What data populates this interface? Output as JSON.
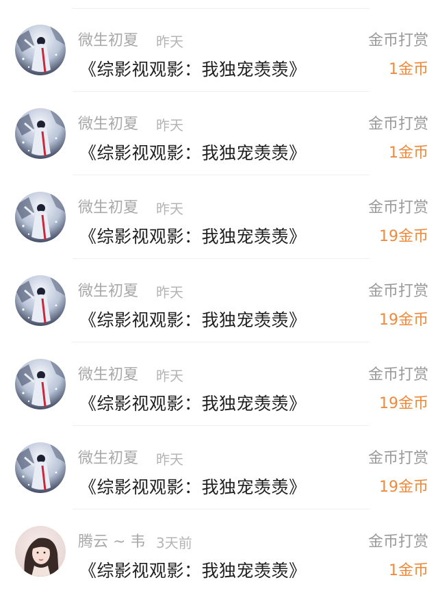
{
  "reward_list": [
    {
      "user": "微生初夏",
      "time": "昨天",
      "type": "金币打赏",
      "book": "《综影视观影：我独宠羡羡》",
      "amount": "1金币",
      "avatar_icon": "ancient-costume-avatar"
    },
    {
      "user": "微生初夏",
      "time": "昨天",
      "type": "金币打赏",
      "book": "《综影视观影：我独宠羡羡》",
      "amount": "1金币",
      "avatar_icon": "ancient-costume-avatar"
    },
    {
      "user": "微生初夏",
      "time": "昨天",
      "type": "金币打赏",
      "book": "《综影视观影：我独宠羡羡》",
      "amount": "19金币",
      "avatar_icon": "ancient-costume-avatar"
    },
    {
      "user": "微生初夏",
      "time": "昨天",
      "type": "金币打赏",
      "book": "《综影视观影：我独宠羡羡》",
      "amount": "19金币",
      "avatar_icon": "ancient-costume-avatar"
    },
    {
      "user": "微生初夏",
      "time": "昨天",
      "type": "金币打赏",
      "book": "《综影视观影：我独宠羡羡》",
      "amount": "19金币",
      "avatar_icon": "ancient-costume-avatar"
    },
    {
      "user": "微生初夏",
      "time": "昨天",
      "type": "金币打赏",
      "book": "《综影视观影：我独宠羡羡》",
      "amount": "19金币",
      "avatar_icon": "ancient-costume-avatar"
    },
    {
      "user": "腾云 ~ 韦",
      "time": "3天前",
      "type": "金币打赏",
      "book": "《综影视观影：我独宠羡羡》",
      "amount": "1金币",
      "avatar_icon": "portrait-avatar"
    }
  ],
  "colors": {
    "amount": "#ee8a3c",
    "username": "#a8a8a8",
    "reward_type": "#9a9a9a",
    "book_title": "#1f1f1f",
    "divider": "#efefef"
  }
}
